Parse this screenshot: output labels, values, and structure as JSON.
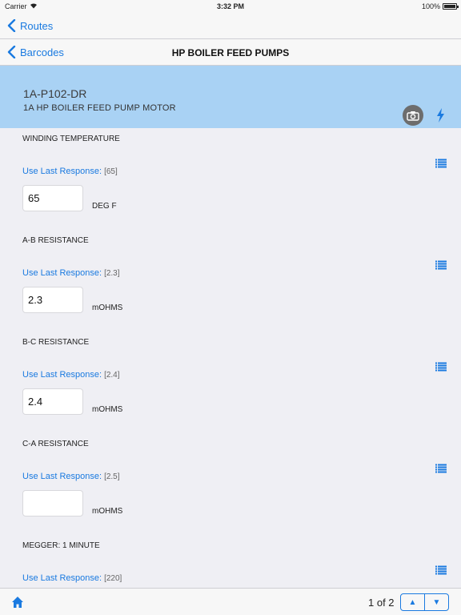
{
  "status_bar": {
    "carrier": "Carrier",
    "time": "3:32 PM",
    "battery": "100%",
    "battery_level": 1.0
  },
  "nav": {
    "routes_back": "Routes",
    "barcodes_back": "Barcodes",
    "title": "HP BOILER FEED PUMPS"
  },
  "asset": {
    "id": "1A-P102-DR",
    "description": "1A HP BOILER FEED PUMP MOTOR"
  },
  "readings": [
    {
      "label": "WINDING TEMPERATURE",
      "last_response_label": "Use Last Response:",
      "last_response_value": "[65]",
      "value": "65",
      "unit": "DEG F"
    },
    {
      "label": "A-B RESISTANCE",
      "last_response_label": "Use Last Response:",
      "last_response_value": "[2.3]",
      "value": "2.3",
      "unit": "mOHMS"
    },
    {
      "label": "B-C RESISTANCE",
      "last_response_label": "Use Last Response:",
      "last_response_value": "[2.4]",
      "value": "2.4",
      "unit": "mOHMS"
    },
    {
      "label": "C-A RESISTANCE",
      "last_response_label": "Use Last Response:",
      "last_response_value": "[2.5]",
      "value": "",
      "unit": "mOHMS"
    },
    {
      "label": "MEGGER: 1 MINUTE",
      "last_response_label": "Use Last Response:",
      "last_response_value": "[220]",
      "value": "",
      "unit": ""
    }
  ],
  "pager": {
    "text": "1 of 2",
    "up_symbol": "▲",
    "down_symbol": "▼"
  },
  "colors": {
    "accent": "#1a7ae0",
    "header_bg": "#a9d2f4",
    "page_bg": "#efeff4"
  }
}
